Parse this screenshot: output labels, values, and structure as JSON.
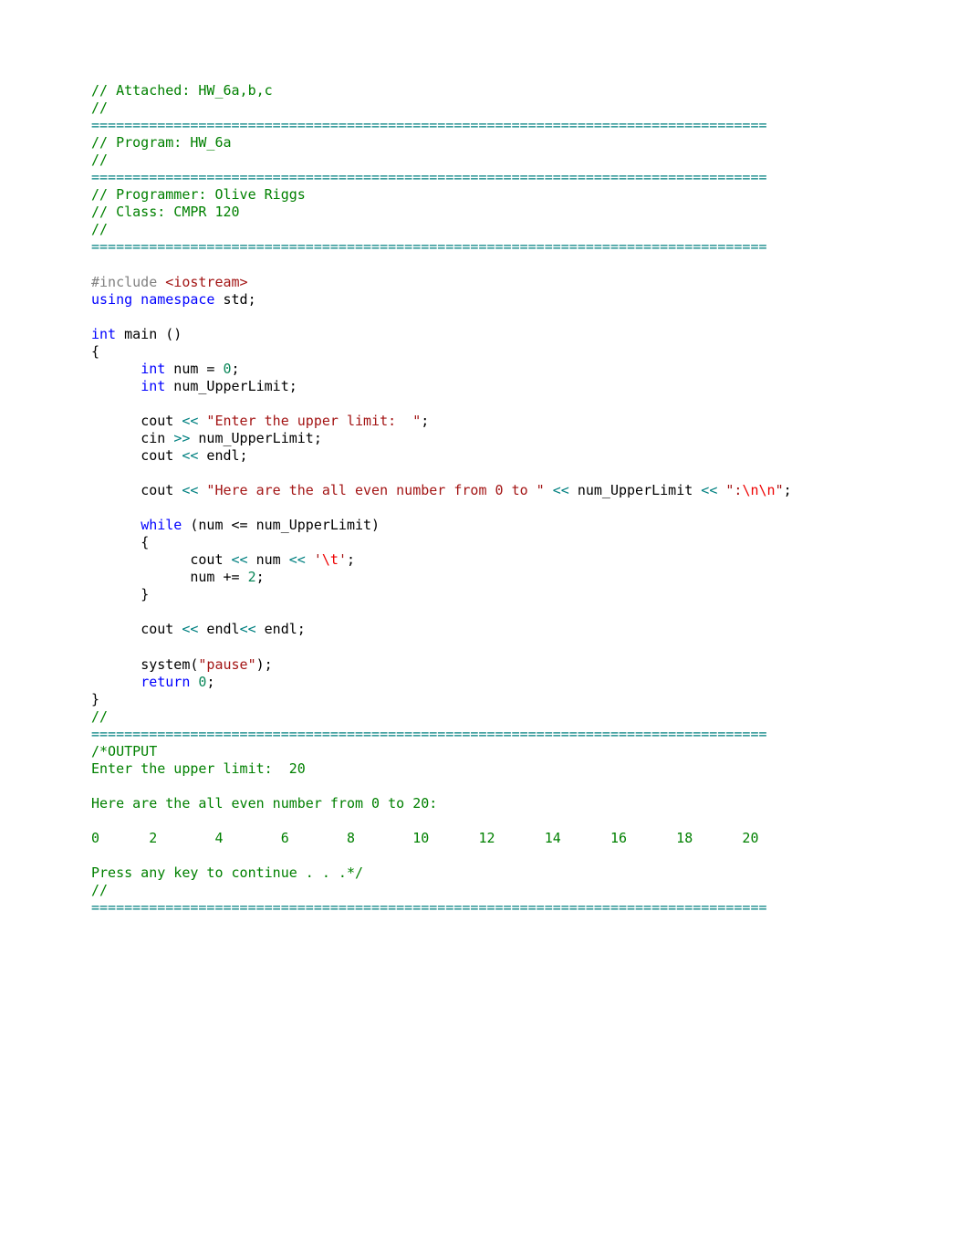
{
  "c": {
    "attached": "// Attached: HW_6a,b,c",
    "sl": "// ",
    "sep": "==================================================================================",
    "program": "// Program: HW_6a",
    "programmer": "// Programmer: Olive Riggs",
    "class": "// Class: CMPR 120",
    "pp_include": "#include",
    "iostream": " <iostream>",
    "using": "using",
    "namespace": " namespace",
    "std": " std",
    "semi": ";",
    "int": "int",
    "main": " main ()",
    "lbrace": "{",
    "indent1": "      ",
    "indent2": "            ",
    "num_eq": " num = ",
    "zero": "0",
    "numUpper": " num_UpperLimit;",
    "cout1a": "cout ",
    "lshift": "<<",
    "prompt": " \"Enter the upper limit:  \"",
    "cin": "cin ",
    "rshift": ">>",
    "cinvar": " num_UpperLimit;",
    "endl": " endl;",
    "herepre": " \"Here are the all even number from 0 to \"",
    "numupper_out": " num_UpperLimit ",
    "colonnn_a": " \":",
    "colonnn_b": "\\n\\n",
    "colonnn_c": "\"",
    "while": "while",
    "while_cond": " (num <= num_UpperLimit)",
    "coutnum": " num ",
    "sq1": " '",
    "tabesc": "\\t",
    "sq2": "'",
    "numpluseq": "num += ",
    "two": "2",
    "rbrace": "}",
    "endl2": " endl",
    "endl2b": " endl;",
    "system": "system(",
    "pause": "\"pause\"",
    "system_end": ");",
    "return": "return",
    "ret0": " 0",
    "output_hdr": "/*OUTPUT",
    "out1": "Enter the upper limit:  20",
    "out2": "Here are the all even number from 0 to 20:",
    "out3": "0      2       4       6       8       10      12      14      16      18      20",
    "out4": "Press any key to continue . . .*/"
  }
}
